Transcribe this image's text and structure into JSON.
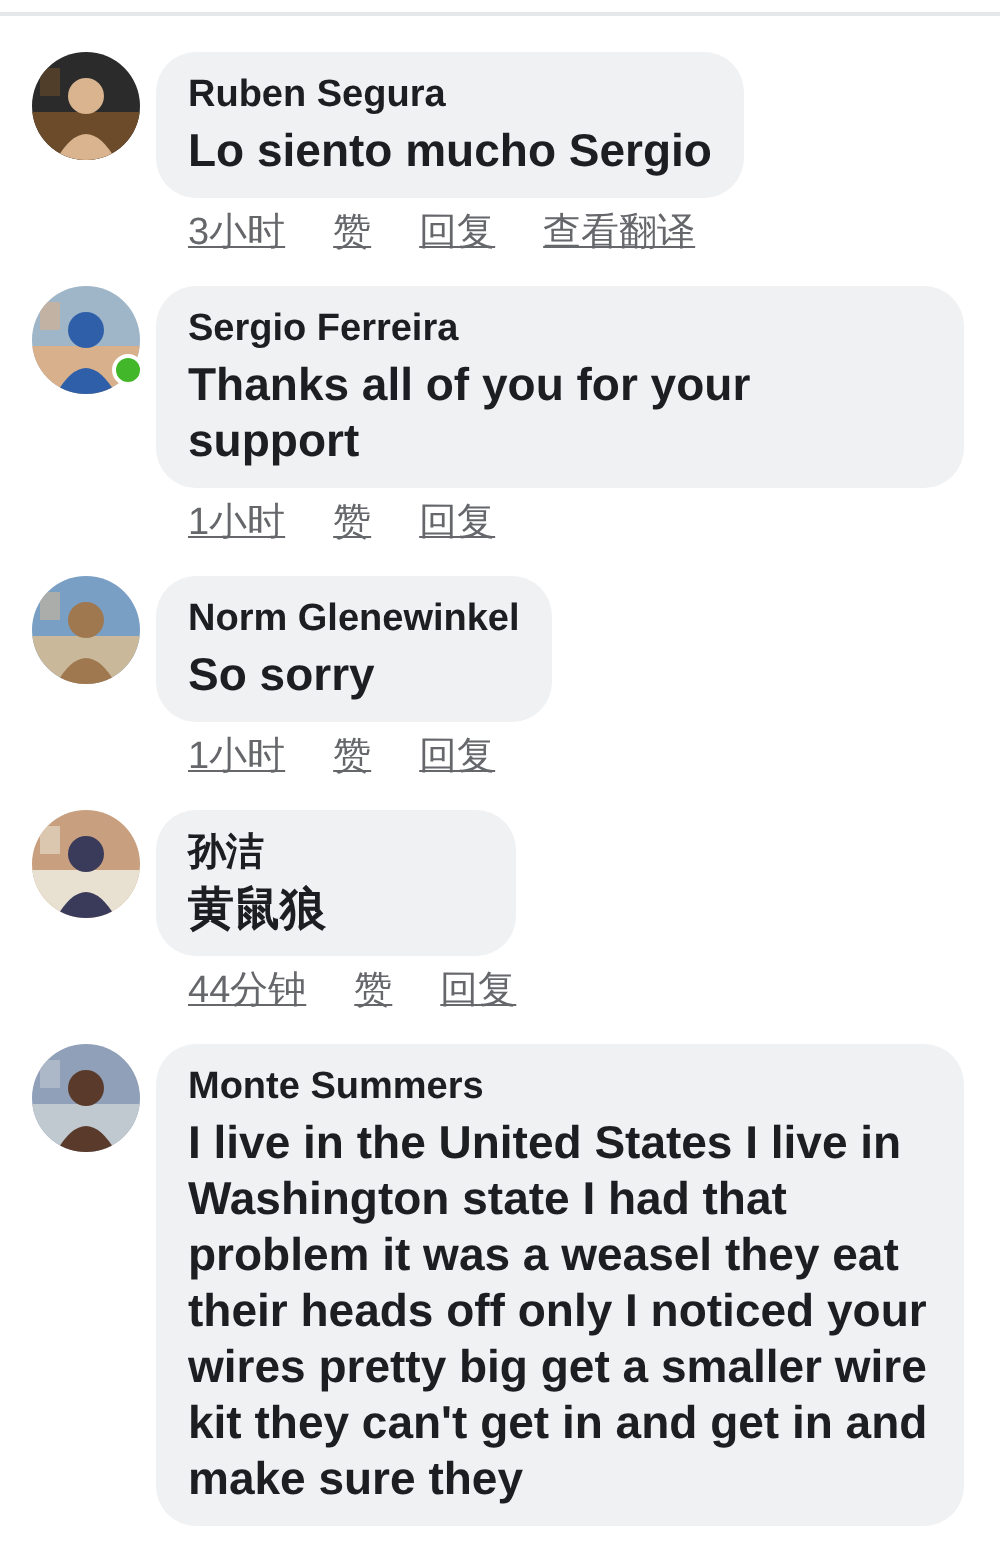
{
  "comments": [
    {
      "author": "Ruben Segura",
      "text": "Lo siento mucho Sergio",
      "online": false,
      "time": "3小时",
      "actions": [
        "赞",
        "回复",
        "查看翻译"
      ]
    },
    {
      "author": "Sergio Ferreira",
      "text": "Thanks all of you for your support",
      "online": true,
      "time": "1小时",
      "actions": [
        "赞",
        "回复"
      ]
    },
    {
      "author": "Norm Glenewinkel",
      "text": "So sorry",
      "online": false,
      "time": "1小时",
      "actions": [
        "赞",
        "回复"
      ]
    },
    {
      "author": "孙洁",
      "text": "黄鼠狼",
      "online": false,
      "time": "44分钟",
      "actions": [
        "赞",
        "回复"
      ]
    },
    {
      "author": "Monte Summers",
      "text": "I live in the United States I live in Washington state I had that problem it was a weasel they eat their heads off only I noticed your wires pretty big get a smaller wire kit they can't get in and get in and make sure they",
      "online": false
    }
  ]
}
